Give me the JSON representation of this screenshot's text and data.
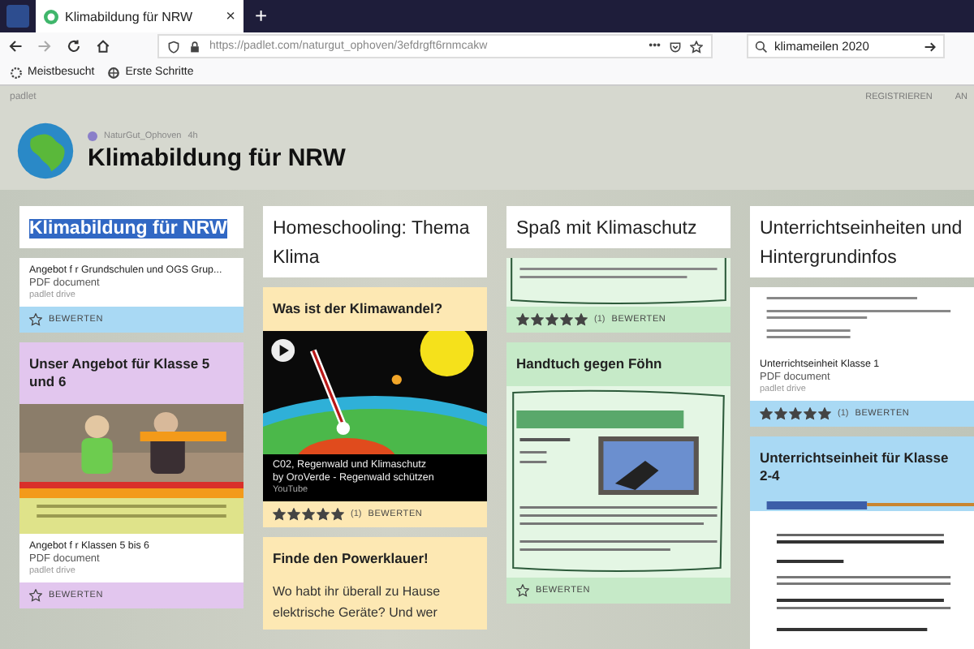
{
  "browser": {
    "tab_title": "Klimabildung für NRW",
    "tab_close": "×",
    "new_tab": "+",
    "url": "https://padlet.com/naturgut_ophoven/3efdrgft6rnmcakw",
    "url_menu": "•••",
    "search": "klimameilen 2020",
    "bookmarks": [
      "Meistbesucht",
      "Erste Schritte"
    ]
  },
  "header": {
    "brand": "padlet",
    "links": [
      "REGISTRIEREN",
      "AN"
    ],
    "author": "NaturGut_Ophoven",
    "age": "4h",
    "title": "Klimabildung für NRW"
  },
  "columns": [
    {
      "title": "Klimabildung für NRW",
      "highlighted": true,
      "cards": [
        {
          "color": "#a9d9f4",
          "parts": [
            {
              "kind": "attachment",
              "title": "Angebot f r Grundschulen und OGS Grup...",
              "type": "PDF document",
              "source": "padlet drive"
            },
            {
              "kind": "rating",
              "label": "BEWERTEN"
            }
          ]
        },
        {
          "color": "#e2c6ee",
          "parts": [
            {
              "kind": "title",
              "text": "Unser Angebot für Klasse 5 und 6"
            },
            {
              "kind": "picture"
            },
            {
              "kind": "attachment",
              "title": "Angebot f r Klassen 5 bis 6",
              "type": "PDF document",
              "source": "padlet drive"
            },
            {
              "kind": "rating",
              "label": "BEWERTEN"
            }
          ]
        }
      ]
    },
    {
      "title": "Homeschooling: Thema Klima",
      "highlighted": false,
      "cards": [
        {
          "color": "#fde8b3",
          "parts": [
            {
              "kind": "title",
              "text": "Was ist der Klimawandel?"
            },
            {
              "kind": "picture"
            },
            {
              "kind": "video",
              "title": "C02, Regenwald und Klimaschutz",
              "author": "by OroVerde - Regenwald schützen",
              "source": "YouTube"
            },
            {
              "kind": "rating",
              "stars": 5,
              "count": "(1)",
              "label": "BEWERTEN"
            }
          ]
        },
        {
          "color": "#fde8b3",
          "parts": [
            {
              "kind": "title",
              "text": "Finde den Powerklauer!"
            },
            {
              "kind": "body",
              "text": "Wo habt ihr überall zu Hause elektrische Geräte? Und wer"
            }
          ]
        }
      ]
    },
    {
      "title": "Spaß mit Klimaschutz",
      "highlighted": false,
      "cards": [
        {
          "color": "#c6eac8",
          "parts": [
            {
              "kind": "picture"
            },
            {
              "kind": "rating",
              "stars": 5,
              "count": "(1)",
              "label": "BEWERTEN"
            }
          ]
        },
        {
          "color": "#c6eac8",
          "parts": [
            {
              "kind": "title",
              "text": "Handtuch gegen Föhn"
            },
            {
              "kind": "picture"
            },
            {
              "kind": "rating",
              "label": "BEWERTEN"
            }
          ]
        }
      ]
    },
    {
      "title": "Unterrichtseinheiten und Hintergrundinfos",
      "highlighted": false,
      "cards": [
        {
          "color": "#a9d9f4",
          "parts": [
            {
              "kind": "picture"
            },
            {
              "kind": "attachment",
              "title": "Unterrichtseinheit Klasse 1",
              "type": "PDF document",
              "source": "padlet drive"
            },
            {
              "kind": "rating",
              "stars": 5,
              "count": "(1)",
              "label": "BEWERTEN"
            }
          ]
        },
        {
          "color": "#a9d9f4",
          "parts": [
            {
              "kind": "title",
              "text": "Unterrichtseinheit für Klasse 2-4"
            },
            {
              "kind": "picture"
            }
          ]
        }
      ]
    }
  ]
}
